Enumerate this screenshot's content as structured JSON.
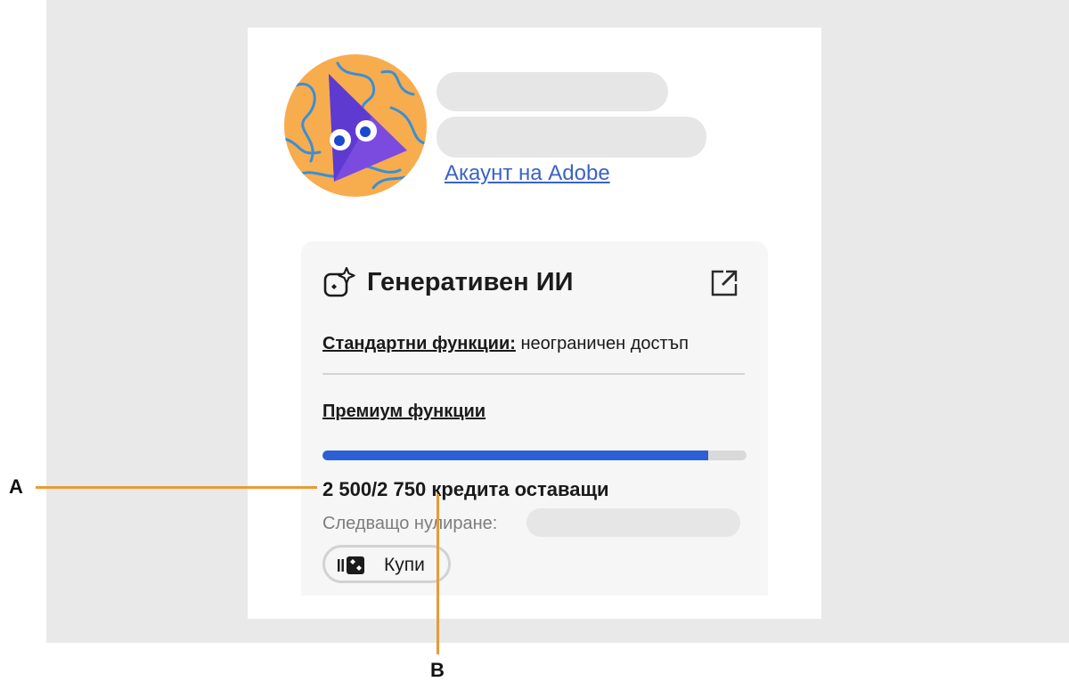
{
  "profile": {
    "account_link": "Акаунт на Adobe"
  },
  "genai_card": {
    "title": "Генеративен ИИ",
    "standard_label": "Стандартни функции:",
    "standard_value": "неограничен достъп",
    "premium_label": "Премиум функции",
    "credits_used_fraction": 0.91,
    "credits_text": "2 500/2 750 кредита оставащи",
    "reset_label": "Следващо нулиране:",
    "buy_label": "Купи"
  },
  "callouts": {
    "a": "A",
    "b": "B"
  },
  "icons": [
    "avatar-illustration",
    "generative-ai-icon",
    "external-link-icon",
    "credits-icon"
  ],
  "colors": {
    "accent": "#2c5fd6",
    "link": "#3b63c4",
    "callout_line": "#ea9a35",
    "avatar_bg": "#f7ac4e"
  }
}
